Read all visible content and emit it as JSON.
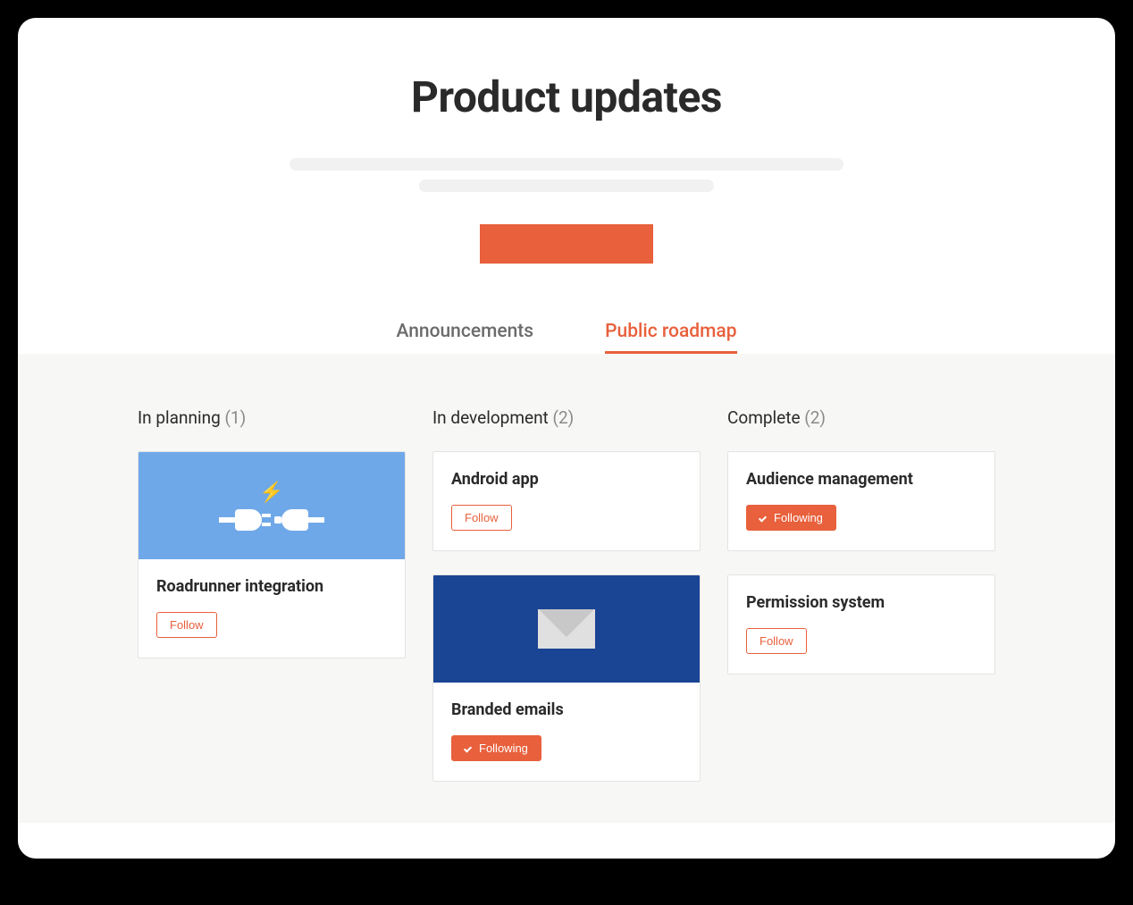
{
  "page": {
    "title": "Product updates"
  },
  "colors": {
    "accent": "#e8603c",
    "card_blue": "#6fa8e8",
    "card_navy": "#1a4494"
  },
  "tabs": [
    {
      "label": "Announcements",
      "active": false
    },
    {
      "label": "Public roadmap",
      "active": true
    }
  ],
  "buttons": {
    "follow": "Follow",
    "following": "Following"
  },
  "columns": [
    {
      "title": "In planning",
      "count": "(1)",
      "cards": [
        {
          "title": "Roadrunner integration",
          "following": false,
          "image": "plug"
        }
      ]
    },
    {
      "title": "In development",
      "count": "(2)",
      "cards": [
        {
          "title": "Android app",
          "following": false,
          "image": null
        },
        {
          "title": "Branded emails",
          "following": true,
          "image": "envelope"
        }
      ]
    },
    {
      "title": "Complete",
      "count": " (2)",
      "cards": [
        {
          "title": "Audience management",
          "following": true,
          "image": null
        },
        {
          "title": "Permission system",
          "following": false,
          "image": null
        }
      ]
    }
  ]
}
